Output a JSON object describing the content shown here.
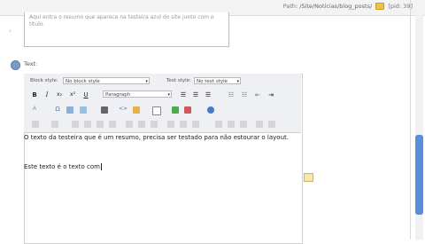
{
  "breadcrumb": {
    "path_label": "Path:",
    "path_value": "/Site/Noticias/blog_posts/",
    "page_id": "[pid: 39]"
  },
  "summary": {
    "text": "Aqui entra o resumo que aparece na testeira azul do site junto com o título."
  },
  "text_field": {
    "label": "Text:"
  },
  "toolbar": {
    "block_style_label": "Block style:",
    "block_style_value": "No block style",
    "text_style_label": "Text style:",
    "text_style_value": "No text style",
    "format_value": "Paragraph",
    "bold": "B",
    "italic": "I",
    "subscript": "x₂",
    "superscript": "x²",
    "underline": "U"
  },
  "editor": {
    "line1": "O texto da testeira que é um resumo, precisa ser testado para não estourar o layout.",
    "line2": "Este texto é o texto com"
  },
  "colors": {
    "accent": "#5a8ed6",
    "folder": "#f0c24b"
  }
}
